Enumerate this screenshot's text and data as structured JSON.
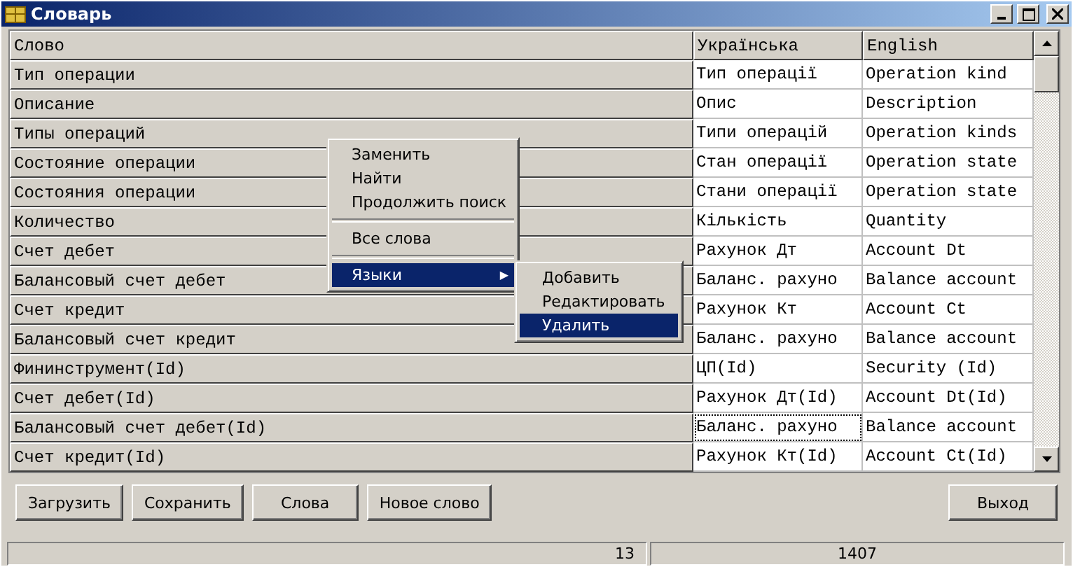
{
  "window": {
    "title": "Словарь"
  },
  "table": {
    "columns": [
      "Слово",
      "Українська",
      "English"
    ],
    "rows": [
      {
        "cells": [
          "Тип операции",
          "Тип операції",
          "Operation kind"
        ],
        "focused": false
      },
      {
        "cells": [
          "Описание",
          "Опис",
          "Description"
        ],
        "focused": false
      },
      {
        "cells": [
          "Типы операций",
          "Типи операцій",
          "Operation kinds"
        ],
        "focused": false
      },
      {
        "cells": [
          "Состояние операции",
          "Стан операції",
          "Operation state"
        ],
        "focused": false
      },
      {
        "cells": [
          "Состояния операции",
          "Стани операції",
          "Operation state"
        ],
        "focused": false
      },
      {
        "cells": [
          "Количество",
          "Кількість",
          "Quantity"
        ],
        "focused": false
      },
      {
        "cells": [
          "Счет дебет",
          "Рахунок Дт",
          "Account Dt"
        ],
        "focused": false
      },
      {
        "cells": [
          "Балансовый счет дебет",
          "Баланс. рахуно",
          "Balance account"
        ],
        "focused": false
      },
      {
        "cells": [
          "Счет кредит",
          "Рахунок Кт",
          "Account Ct"
        ],
        "focused": false
      },
      {
        "cells": [
          "Балансовый счет кредит",
          "Баланс. рахуно",
          "Balance account"
        ],
        "focused": false
      },
      {
        "cells": [
          "Фининструмент(Id)",
          "ЦП(Id)",
          "Security (Id)"
        ],
        "focused": false
      },
      {
        "cells": [
          "Счет дебет(Id)",
          "Рахунок Дт(Id)",
          "Account Dt(Id)"
        ],
        "focused": false
      },
      {
        "cells": [
          "Балансовый счет дебет(Id)",
          "Баланс. рахуно",
          "Balance account"
        ],
        "focused": true
      },
      {
        "cells": [
          "Счет кредит(Id)",
          "Рахунок Кт(Id)",
          "Account Ct(Id)"
        ],
        "focused": false
      }
    ]
  },
  "context_menu": {
    "items": [
      {
        "kind": "item",
        "label": "Заменить",
        "selected": false
      },
      {
        "kind": "item",
        "label": "Найти",
        "selected": false
      },
      {
        "kind": "item",
        "label": "Продолжить поиск",
        "selected": false
      },
      {
        "kind": "separator"
      },
      {
        "kind": "item",
        "label": "Все слова",
        "selected": false
      },
      {
        "kind": "separator"
      },
      {
        "kind": "submenu",
        "label": "Языки",
        "selected": true,
        "arrow": "▶"
      }
    ],
    "submenu": [
      {
        "label": "Добавить",
        "selected": false
      },
      {
        "label": "Редактировать",
        "selected": false
      },
      {
        "label": "Удалить",
        "selected": true
      }
    ]
  },
  "buttons": [
    "Загрузить",
    "Сохранить",
    "Слова",
    "Новое слово"
  ],
  "exit_button": "Выход",
  "status_bar": [
    "13",
    "1407"
  ]
}
